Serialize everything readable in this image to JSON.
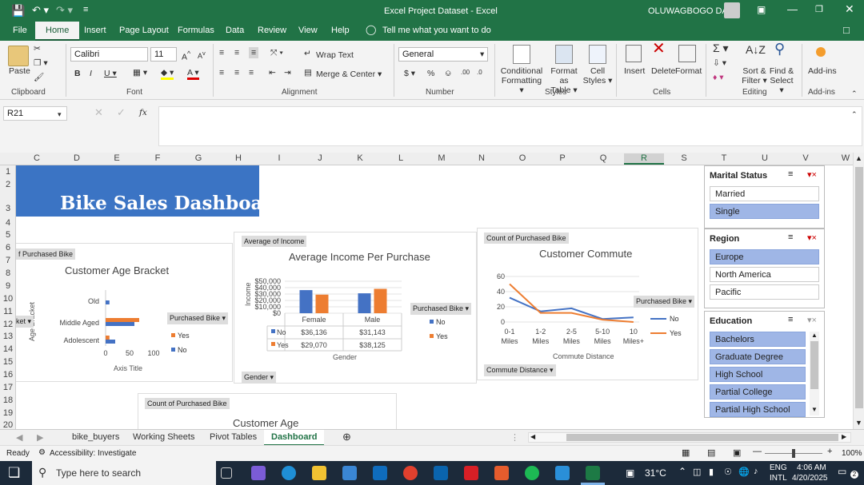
{
  "app": {
    "window_title": "Excel Project Dataset  -  Excel",
    "user": "OLUWAGBOGO DADA"
  },
  "menu": [
    "File",
    "Home",
    "Insert",
    "Page Layout",
    "Formulas",
    "Data",
    "Review",
    "View",
    "Help"
  ],
  "tell_me": "Tell me what you want to do",
  "ribbon": {
    "font_name": "Calibri",
    "font_size": "11",
    "wrap_text": "Wrap Text",
    "merge_center": "Merge & Center",
    "number_format": "General",
    "paste": "Paste",
    "conditional": [
      "Conditional",
      "Formatting ▾"
    ],
    "format_table": [
      "Format as",
      "Table ▾"
    ],
    "cell_styles": [
      "Cell",
      "Styles ▾"
    ],
    "insert": "Insert",
    "delete": "Delete",
    "format": "Format",
    "sort_filter": [
      "Sort &",
      "Filter ▾"
    ],
    "find_select": [
      "Find &",
      "Select ▾"
    ],
    "addins": "Add-ins",
    "groups": [
      "Clipboard",
      "Font",
      "Alignment",
      "Number",
      "Styles",
      "Cells",
      "Editing",
      "Add-ins"
    ]
  },
  "formula_bar": {
    "name_box": "R21",
    "fx": "fx",
    "content": ""
  },
  "columns": [
    "C",
    "D",
    "E",
    "F",
    "G",
    "H",
    "I",
    "J",
    "K",
    "L",
    "M",
    "N",
    "O",
    "P",
    "Q",
    "R",
    "S",
    "T",
    "U",
    "V",
    "W"
  ],
  "rows": [
    "1",
    "2",
    "3",
    "4",
    "5",
    "6",
    "7",
    "8",
    "9",
    "10",
    "11",
    "12",
    "13",
    "14",
    "15",
    "16",
    "17",
    "18",
    "19",
    "20"
  ],
  "dashboard": {
    "title": "Bike Sales Dashboard",
    "cell_fragment_left": "ket ▾",
    "chip_fragment_left": "f Purchased Bike"
  },
  "chart_data": [
    {
      "type": "bar",
      "title": "Customer Age Bracket",
      "chip": "Purchased Bike",
      "ylabel": "Age Bracket",
      "xlabel": "Axis Title",
      "categories": [
        "Old",
        "Middle Aged",
        "Adolescent"
      ],
      "series": [
        {
          "name": "Yes",
          "values": [
            0,
            70,
            8
          ]
        },
        {
          "name": "No",
          "values": [
            8,
            60,
            20
          ]
        }
      ],
      "xticks": [
        "0",
        "50",
        "100"
      ],
      "xlim": [
        0,
        100
      ],
      "legend_title": "Purchased Bike ▾",
      "colors": {
        "Yes": "#ed7d31",
        "No": "#4472c4"
      }
    },
    {
      "type": "bar",
      "title": "Average Income Per Purchase",
      "chip": "Average of Income",
      "ylabel": "Income",
      "xlabel": "Gender",
      "categories": [
        "Female",
        "Male"
      ],
      "series": [
        {
          "name": "No",
          "values": [
            36136,
            31143
          ]
        },
        {
          "name": "Yes",
          "values": [
            29070,
            38125
          ]
        }
      ],
      "yticks": [
        "$50,000",
        "$40,000",
        "$30,000",
        "$20,000",
        "$10,000",
        "$0"
      ],
      "ylim": [
        0,
        50000
      ],
      "table": {
        "No": [
          "$36,136",
          "$31,143"
        ],
        "Yes": [
          "$29,070",
          "$38,125"
        ]
      },
      "legend_title": "Purchased Bike ▾",
      "bottom_chip": "Gender ▾",
      "colors": {
        "Yes": "#ed7d31",
        "No": "#4472c4"
      }
    },
    {
      "type": "line",
      "title": "Customer Commute",
      "chip": "Count of Purchased Bike",
      "xlabel": "Commute Distance",
      "x": [
        "0-1 Miles",
        "1-2 Miles",
        "2-5 Miles",
        "5-10 Miles",
        "10 Miles+"
      ],
      "series": [
        {
          "name": "No",
          "values": [
            32,
            14,
            18,
            4,
            6
          ]
        },
        {
          "name": "Yes",
          "values": [
            50,
            12,
            12,
            3,
            0
          ]
        }
      ],
      "yticks": [
        "60",
        "40",
        "20",
        "0"
      ],
      "ylim": [
        0,
        60
      ],
      "legend_title": "Purchased Bike ▾",
      "bottom_chip": "Commute Distance ▾",
      "colors": {
        "Yes": "#ed7d31",
        "No": "#4472c4"
      }
    },
    {
      "type": "bar",
      "title": "Customer Age",
      "chip": "Count of Purchased Bike"
    }
  ],
  "slicers": [
    {
      "title": "Marital Status",
      "items": [
        {
          "label": "Married",
          "selected": false
        },
        {
          "label": "Single",
          "selected": true
        }
      ]
    },
    {
      "title": "Region",
      "items": [
        {
          "label": "Europe",
          "selected": true
        },
        {
          "label": "North America",
          "selected": false
        },
        {
          "label": "Pacific",
          "selected": false
        }
      ]
    },
    {
      "title": "Education",
      "items": [
        {
          "label": "Bachelors",
          "selected": true
        },
        {
          "label": "Graduate Degree",
          "selected": true
        },
        {
          "label": "High School",
          "selected": true
        },
        {
          "label": "Partial College",
          "selected": true
        },
        {
          "label": "Partial High School",
          "selected": true
        }
      ]
    }
  ],
  "sheet_tabs": [
    "bike_buyers",
    "Working Sheets",
    "Pivot Tables",
    "Dashboard"
  ],
  "active_tab": "Dashboard",
  "status": {
    "ready": "Ready",
    "accessibility": "Accessibility: Investigate",
    "zoom": "100%"
  },
  "taskbar": {
    "search": "Type here to search",
    "weather": "31°C",
    "lang1": "ENG",
    "lang2": "INTL",
    "time": "4:06 AM",
    "date": "4/20/2025",
    "notif": "2"
  }
}
